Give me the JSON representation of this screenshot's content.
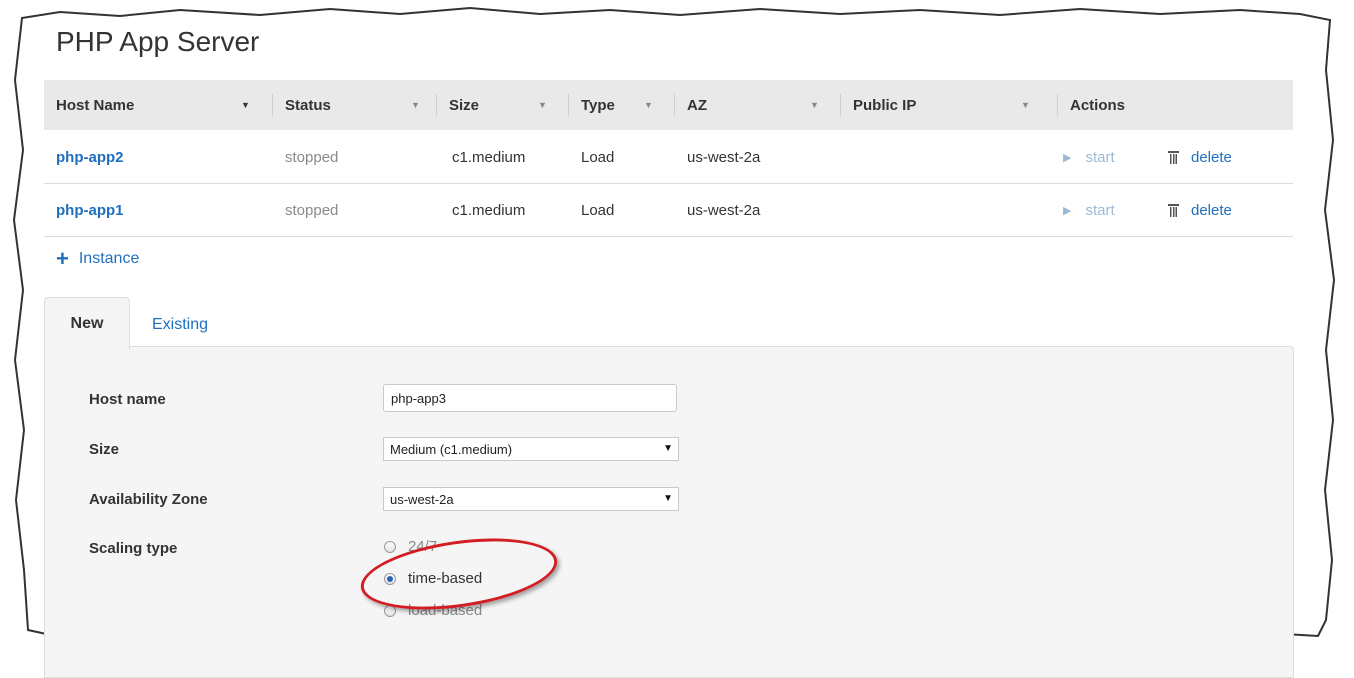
{
  "page": {
    "title": "PHP App Server"
  },
  "table": {
    "columns": [
      "Host Name",
      "Status",
      "Size",
      "Type",
      "AZ",
      "Public IP",
      "Actions"
    ],
    "rows": [
      {
        "host": "php-app2",
        "status": "stopped",
        "size": "c1.medium",
        "type": "Load",
        "az": "us-west-2a",
        "public_ip": "",
        "start": "start",
        "delete": "delete"
      },
      {
        "host": "php-app1",
        "status": "stopped",
        "size": "c1.medium",
        "type": "Load",
        "az": "us-west-2a",
        "public_ip": "",
        "start": "start",
        "delete": "delete"
      }
    ]
  },
  "add_instance": {
    "label": "Instance",
    "icon": "plus-icon"
  },
  "tabs": [
    {
      "label": "New",
      "active": true
    },
    {
      "label": "Existing",
      "active": false
    }
  ],
  "form": {
    "host_name": {
      "label": "Host name",
      "value": "php-app3"
    },
    "size": {
      "label": "Size",
      "value": "Medium (c1.medium)"
    },
    "availability_zone": {
      "label": "Availability Zone",
      "value": "us-west-2a"
    },
    "scaling_type": {
      "label": "Scaling type",
      "options": [
        "24/7",
        "time-based",
        "load-based"
      ],
      "selected": "time-based"
    }
  },
  "colors": {
    "link": "#1f6fbf",
    "highlight_ring": "#d21d23",
    "header_bg": "#e9e9e9"
  }
}
